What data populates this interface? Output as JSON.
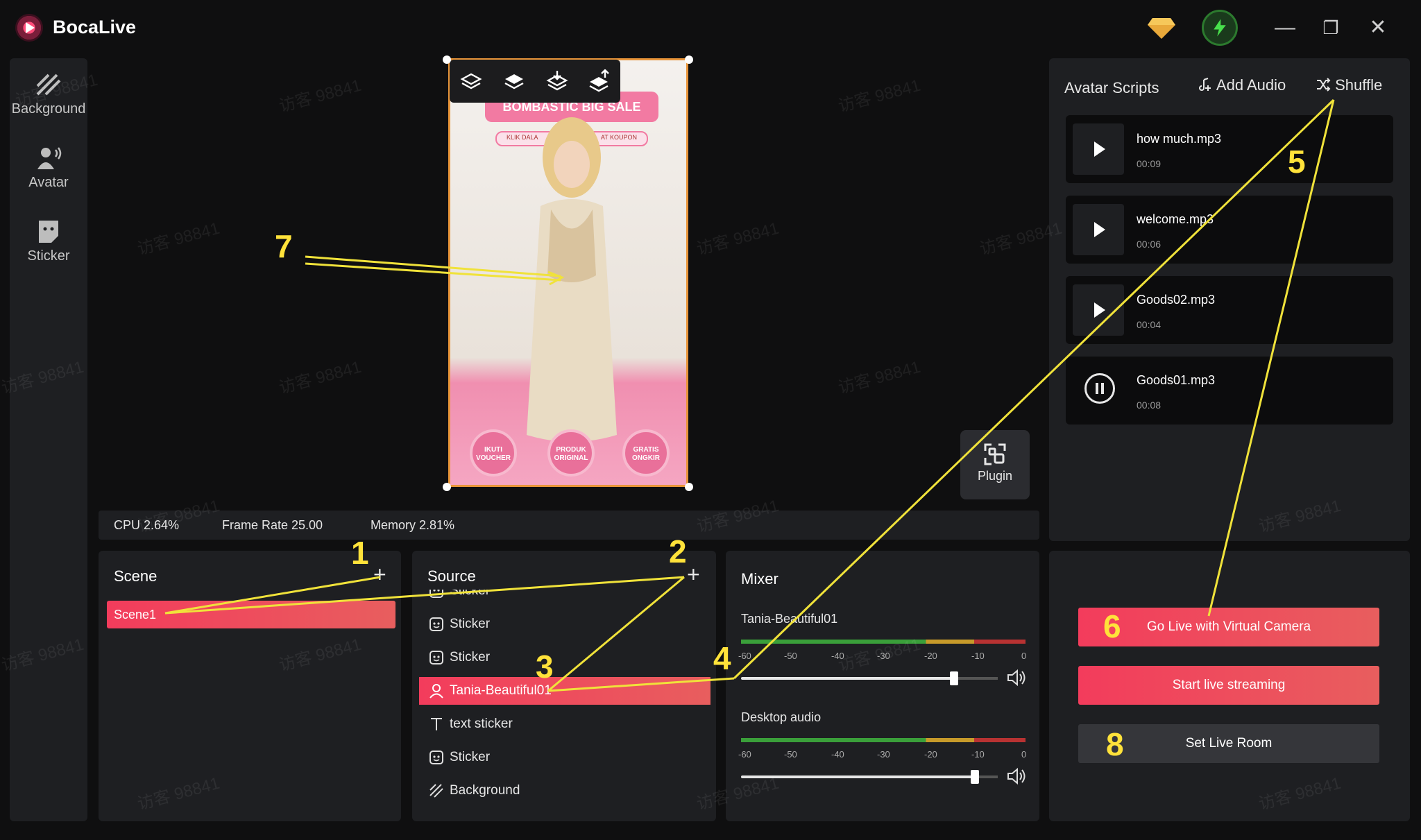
{
  "app": {
    "title": "BocaLive"
  },
  "titlebar": {
    "minimize": "—",
    "restore": "❐",
    "close": "✕"
  },
  "sidebar": {
    "items": [
      {
        "label": "Background",
        "icon": "background-icon"
      },
      {
        "label": "Avatar",
        "icon": "avatar-icon"
      },
      {
        "label": "Sticker",
        "icon": "sticker-icon"
      }
    ]
  },
  "preview": {
    "banner": "BOMBASTIC BIG SALE",
    "sub_left": "KLIK DALA",
    "sub_right": "AT KOUPON",
    "badges": [
      "IKUTI VOUCHER",
      "PRODUK ORIGINAL",
      "GRATIS ONGKIR"
    ]
  },
  "plugin": {
    "label": "Plugin"
  },
  "status": {
    "cpu": "CPU 2.64%",
    "frame_rate": "Frame Rate 25.00",
    "memory": "Memory 2.81%"
  },
  "scene": {
    "title": "Scene",
    "add": "+",
    "items": [
      "Scene1"
    ]
  },
  "source": {
    "title": "Source",
    "add": "+",
    "items": [
      {
        "label": "Sticker",
        "icon": "sticker-icon"
      },
      {
        "label": "Sticker",
        "icon": "sticker-icon"
      },
      {
        "label": "Sticker",
        "icon": "sticker-icon"
      },
      {
        "label": "Tania-Beautiful01",
        "icon": "person-icon",
        "selected": true
      },
      {
        "label": "text sticker",
        "icon": "text-icon"
      },
      {
        "label": "Sticker",
        "icon": "sticker-icon"
      },
      {
        "label": "Background",
        "icon": "background-icon"
      }
    ]
  },
  "mixer": {
    "title": "Mixer",
    "ticks": [
      "-60",
      "-50",
      "-40",
      "-30",
      "-20",
      "-10",
      "0"
    ],
    "channels": [
      {
        "name": "Tania-Beautiful01",
        "volume": 0.83
      },
      {
        "name": "Desktop audio",
        "volume": 0.91
      }
    ]
  },
  "scripts": {
    "title": "Avatar Scripts",
    "add_audio": "Add Audio",
    "shuffle": "Shuffle",
    "items": [
      {
        "name": "how much.mp3",
        "duration": "00:09",
        "state": "play"
      },
      {
        "name": "welcome.mp3",
        "duration": "00:06",
        "state": "play"
      },
      {
        "name": "Goods02.mp3",
        "duration": "00:04",
        "state": "play"
      },
      {
        "name": "Goods01.mp3",
        "duration": "00:08",
        "state": "pause"
      }
    ]
  },
  "actions": {
    "virtual_camera": "Go Live with Virtual Camera",
    "start_streaming": "Start live streaming",
    "set_room": "Set Live Room"
  },
  "annotations": [
    "1",
    "2",
    "3",
    "4",
    "5",
    "6",
    "7",
    "8"
  ],
  "watermark": "访客 98841"
}
